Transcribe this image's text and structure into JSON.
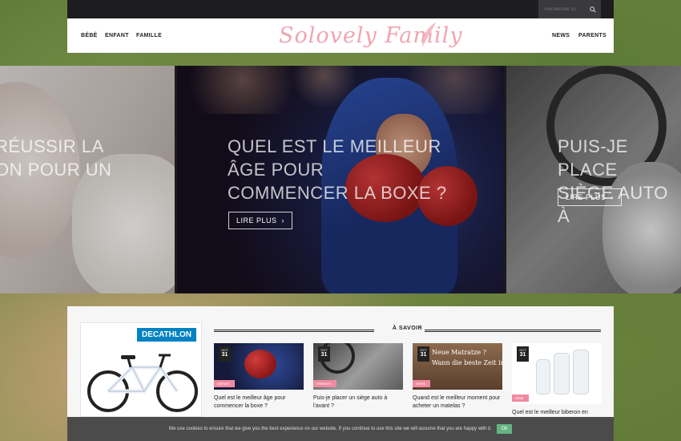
{
  "search": {
    "placeholder": "Rechercher ici"
  },
  "nav": {
    "left": [
      "BÉBÉ",
      "ENFANT",
      "FAMILLE"
    ],
    "logo": "Solovely Family",
    "right": [
      "NEWS",
      "PARENTS"
    ]
  },
  "slider": {
    "slides": [
      {
        "title_lines": [
          "RÉUSSIR LA",
          "ON POUR UN"
        ]
      },
      {
        "title_lines": [
          "QUEL EST LE MEILLEUR",
          "ÂGE POUR",
          "COMMENCER LA BOXE ?"
        ],
        "button": "LIRE PLUS"
      },
      {
        "title_lines": [
          "PUIS-JE PLACE",
          "SIÈGE AUTO À"
        ],
        "button": "LIRE PLUS"
      }
    ]
  },
  "ad": {
    "brand": "DECATHLON"
  },
  "section": {
    "heading": "À SAVOIR"
  },
  "cards": [
    {
      "month": "OCT",
      "day": "31",
      "tag": "ENFANT",
      "title": "Quel est le meilleur âge pour commencer la boxe ?"
    },
    {
      "month": "OCT",
      "day": "31",
      "tag": "PARENTS",
      "title": "Puis-je placer un siège auto à l'avant ?"
    },
    {
      "month": "OCT",
      "day": "31",
      "tag": "NEWS",
      "title": "Quand est le meilleur moment pour acheter un matelas ?",
      "overlay_lines": [
        "Neue Matratze ?",
        "Wann die beste Zeit in"
      ]
    },
    {
      "month": "OCT",
      "day": "31",
      "tag": "BÉBÉ",
      "title": "Quel est le meilleur biberon en"
    }
  ],
  "cookie": {
    "text": "We use cookies to ensure that we give you the best experience on our website. If you continue to use this site we will assume that you are happy with it.",
    "ok": "Ok"
  }
}
